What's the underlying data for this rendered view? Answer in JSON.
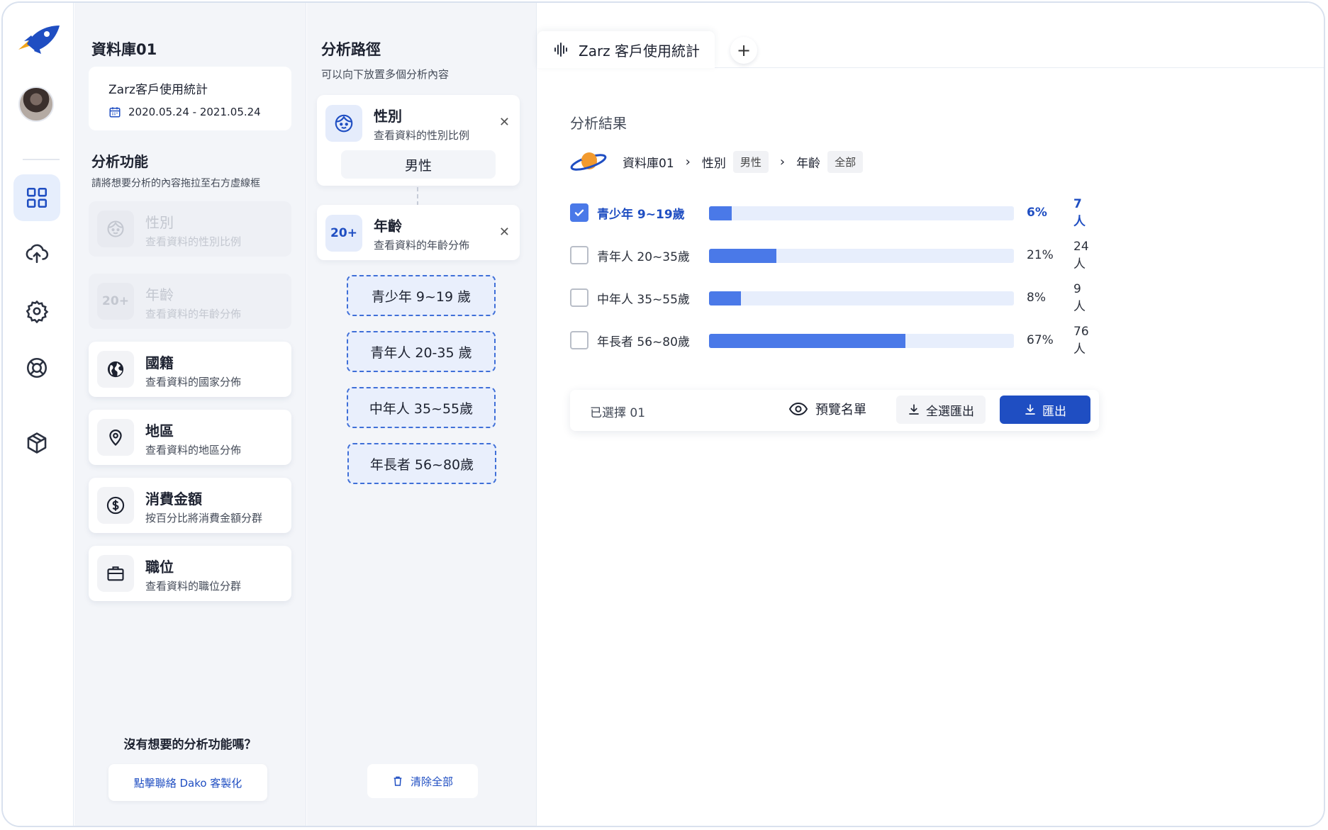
{
  "colors": {
    "accent": "#1f4ec2",
    "bar": "#4a79e8",
    "bar_track": "#e7eefc"
  },
  "rail": {
    "items": [
      {
        "icon": "dashboard-icon",
        "active": true
      },
      {
        "icon": "cloud-upload-icon",
        "active": false
      },
      {
        "icon": "settings-gear-icon",
        "active": false
      },
      {
        "icon": "help-lifebuoy-icon",
        "active": false
      },
      {
        "icon": "package-box-icon",
        "active": false
      }
    ]
  },
  "functions_panel": {
    "database_title": "資料庫01",
    "database_card": {
      "name": "Zarz客戶使用統計",
      "date_range": "2020.05.24 - 2021.05.24"
    },
    "section_title": "分析功能",
    "section_hint": "請將想要分析的內容拖拉至右方虛線框",
    "cards": [
      {
        "title": "性別",
        "desc": "查看資料的性別比例",
        "icon": "face-icon",
        "disabled": true
      },
      {
        "title": "年齡",
        "desc": "查看資料的年齡分佈",
        "icon_text": "20+",
        "disabled": true
      },
      {
        "title": "國籍",
        "desc": "查看資料的國家分佈",
        "icon": "globe-icon",
        "disabled": false
      },
      {
        "title": "地區",
        "desc": "查看資料的地區分佈",
        "icon": "map-pin-icon",
        "disabled": false
      },
      {
        "title": "消費金額",
        "desc": "按百分比將消費金額分群",
        "icon": "dollar-icon",
        "disabled": false
      },
      {
        "title": "職位",
        "desc": "查看資料的職位分群",
        "icon": "briefcase-icon",
        "disabled": false
      }
    ],
    "help_question": "沒有想要的分析功能嗎？",
    "help_button": "點擊聯絡 Dako 客製化"
  },
  "path_panel": {
    "title": "分析路徑",
    "hint": "可以向下放置多個分析內容",
    "gender_card": {
      "title": "性別",
      "desc": "查看資料的性別比例",
      "value": "男性"
    },
    "age_card": {
      "title": "年齡",
      "desc": "查看資料的年齡分佈",
      "icon_text": "20+"
    },
    "close_glyph": "✕",
    "drop_items": [
      "青少年 9~19 歲",
      "青年人 20-35 歲",
      "中年人 35~55歲",
      "年長者 56~80歲"
    ],
    "clear_button": "清除全部"
  },
  "tabs": {
    "active_label": "Zarz 客戶使用統計",
    "add_label": "+"
  },
  "results": {
    "title": "分析結果",
    "breadcrumb": {
      "root": "資料庫01",
      "step1_label": "性別",
      "step1_tag": "男性",
      "step2_label": "年齡",
      "step2_tag": "全部",
      "separator": "›"
    },
    "rows": [
      {
        "label": "青少年  9~19歲",
        "percent": "6%",
        "fraction": 0.075,
        "count": "7人",
        "checked": true
      },
      {
        "label": "青年人 20~35歲",
        "percent": "21%",
        "fraction": 0.22,
        "count": "24人",
        "checked": false
      },
      {
        "label": "中年人 35~55歲",
        "percent": "8%",
        "fraction": 0.105,
        "count": "9人",
        "checked": false
      },
      {
        "label": "年長者 56~80歲",
        "percent": "67%",
        "fraction": 0.645,
        "count": "76人",
        "checked": false
      }
    ],
    "action_bar": {
      "selected_text": "已選擇 01",
      "preview_label": "預覽名單",
      "export_all_label": "全選匯出",
      "export_label": "匯出"
    }
  }
}
